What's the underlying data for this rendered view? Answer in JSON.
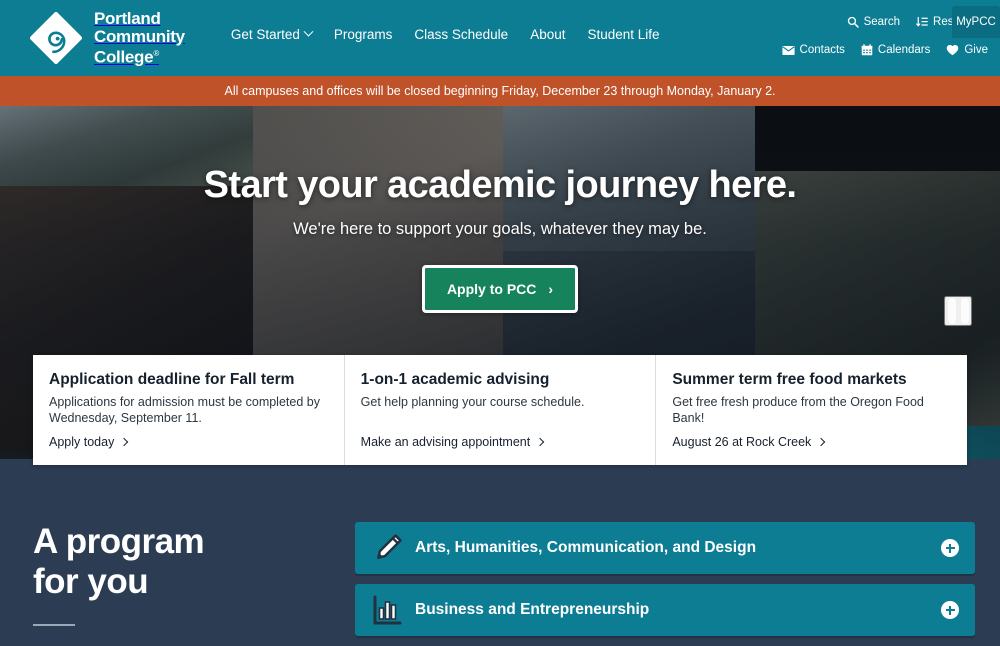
{
  "header": {
    "logo": {
      "icon": "pcc-diamond-spiral-logo",
      "line1": "Portland",
      "line2": "Community",
      "line3": "College",
      "registered": "®"
    },
    "nav": [
      {
        "label": "Get Started",
        "has_dropdown": true
      },
      {
        "label": "Programs",
        "has_dropdown": false
      },
      {
        "label": "Class Schedule",
        "has_dropdown": false
      },
      {
        "label": "About",
        "has_dropdown": false
      },
      {
        "label": "Student Life",
        "has_dropdown": false
      }
    ],
    "utility_row_1": [
      {
        "label": "Search",
        "icon": "search-icon"
      },
      {
        "label": "Resources",
        "icon": "sort-resources-icon"
      }
    ],
    "utility_row_2": [
      {
        "label": "Contacts",
        "icon": "envelope-icon"
      },
      {
        "label": "Calendars",
        "icon": "calendar-icon"
      },
      {
        "label": "Give",
        "icon": "heart-icon"
      }
    ],
    "mypcc_tab": "MyPCC",
    "colors": {
      "teal": "#0d7d94",
      "tab_teal": "#0a6d82"
    }
  },
  "alert": {
    "text": "All campuses and offices will be closed beginning Friday, December 23 through Monday, January 2.",
    "color": "#c0522a"
  },
  "hero": {
    "title": "Start your academic journey here.",
    "subtitle": "We're here to support your goals, whatever they may be.",
    "cta_label": "Apply to PCC",
    "cta_chevron": "›",
    "cta_color": "#17835c",
    "carousel_control": "pause"
  },
  "cards": [
    {
      "title": "Application deadline for Fall term",
      "body": "Applications for admission must be completed by Wednesday, September 11.",
      "link": "Apply today"
    },
    {
      "title": "1-on-1 academic advising",
      "body": "Get help planning your course schedule.",
      "link": "Make an advising appointment"
    },
    {
      "title": "Summer term free food markets",
      "body": "Get free fresh produce from the Oregon Food Bank!",
      "link": "August 26 at Rock Creek"
    }
  ],
  "programs": {
    "heading_line1": "A program",
    "heading_line2": "for you",
    "items": [
      {
        "label": "Arts, Humanities, Communication, and Design",
        "icon": "pencil-icon",
        "expand": "plus-icon"
      },
      {
        "label": "Business and Entrepreneurship",
        "icon": "bar-chart-icon",
        "expand": "plus-icon"
      }
    ],
    "background_color": "#2b3c53",
    "bar_color": "#0d7d94"
  }
}
